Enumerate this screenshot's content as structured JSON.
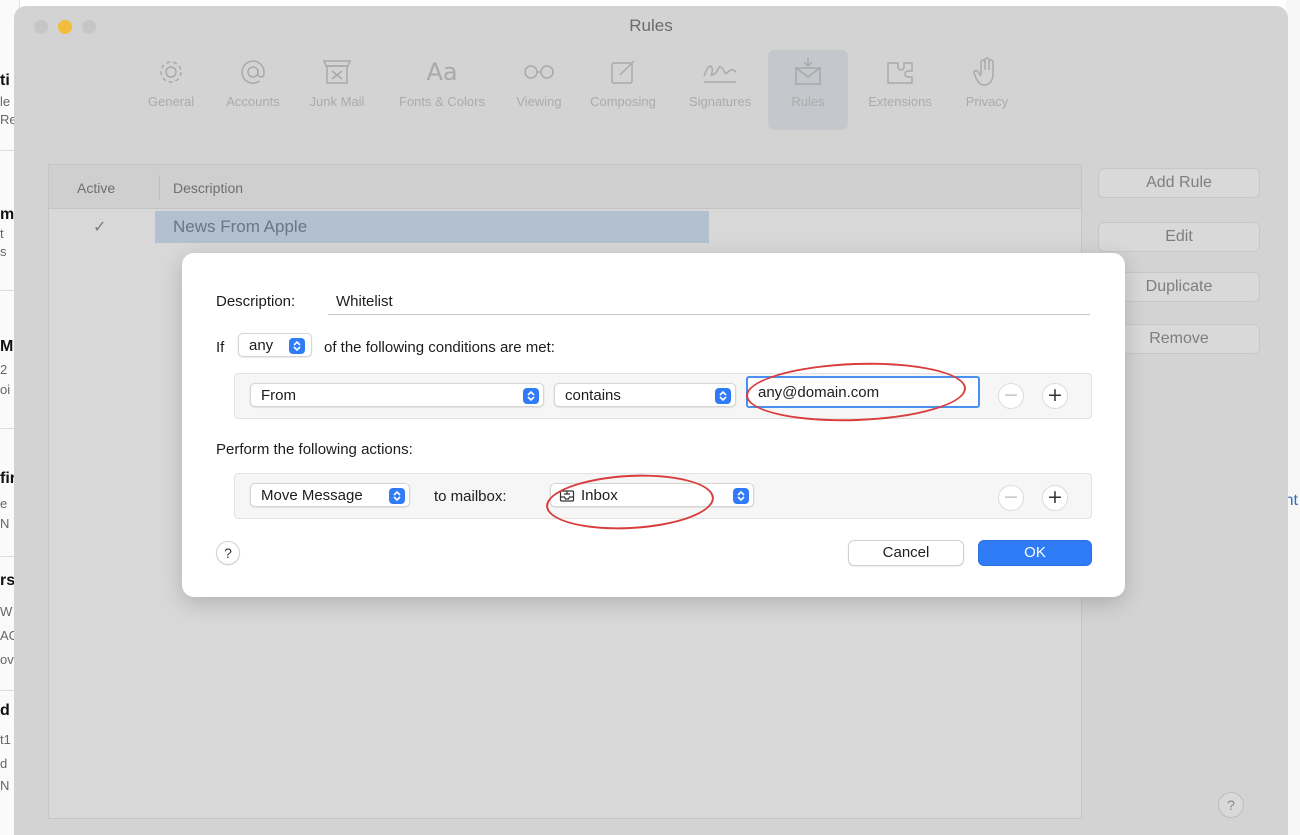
{
  "background": {
    "left_fragments": [
      "ti",
      "le",
      "Re",
      "m",
      "t",
      "s",
      "Mc",
      "2",
      "oi",
      "fir",
      "e",
      "N",
      "rs",
      "W",
      "AC",
      "ov",
      "d",
      "t1",
      "d",
      "N"
    ],
    "right_fragment": "nt"
  },
  "window": {
    "title": "Rules",
    "toolbar": [
      {
        "label": "General",
        "icon": "gear-icon"
      },
      {
        "label": "Accounts",
        "icon": "at-sign-icon"
      },
      {
        "label": "Junk Mail",
        "icon": "junk-mail-icon"
      },
      {
        "label": "Fonts & Colors",
        "icon": "fonts-icon",
        "glyph": "Aa"
      },
      {
        "label": "Viewing",
        "icon": "glasses-icon"
      },
      {
        "label": "Composing",
        "icon": "compose-icon"
      },
      {
        "label": "Signatures",
        "icon": "signature-icon"
      },
      {
        "label": "Rules",
        "icon": "rules-envelope-icon",
        "active": true
      },
      {
        "label": "Extensions",
        "icon": "puzzle-icon"
      },
      {
        "label": "Privacy",
        "icon": "hand-icon"
      }
    ],
    "table": {
      "col_active": "Active",
      "col_description": "Description",
      "rows": [
        {
          "active": "✓",
          "description": "News From Apple"
        }
      ]
    },
    "buttons": {
      "add_rule": "Add Rule",
      "edit": "Edit",
      "duplicate": "Duplicate",
      "remove": "Remove",
      "help": "?"
    }
  },
  "sheet": {
    "description_label": "Description:",
    "description_value": "Whitelist",
    "if_label": "If",
    "condition_match": "any",
    "conditions_suffix": "of the following conditions are met:",
    "condition": {
      "field": "From",
      "operator": "contains",
      "value": "any@domain.com"
    },
    "actions_label": "Perform the following actions:",
    "action": {
      "type": "Move Message",
      "to_label": "to mailbox:",
      "mailbox": "Inbox"
    },
    "minus": "−",
    "plus": "+",
    "help": "?",
    "cancel": "Cancel",
    "ok": "OK"
  },
  "colors": {
    "accent": "#2f7cf6",
    "annotation": "#d93c3c",
    "selection": "#b2c0cf"
  }
}
